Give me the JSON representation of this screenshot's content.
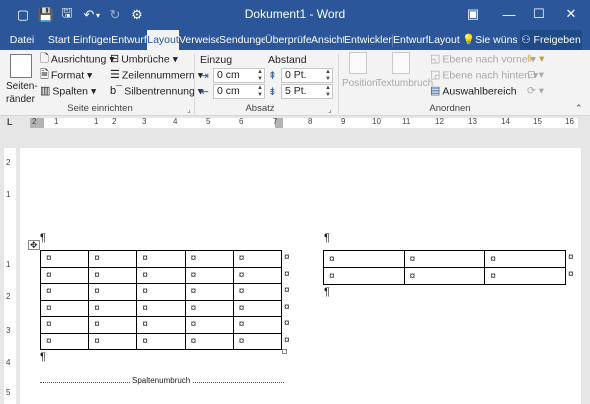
{
  "window": {
    "title": "Dokument1 - Word",
    "controls": {
      "options": "▣",
      "minimize": "—",
      "maximize": "☐",
      "close": "✕"
    }
  },
  "quick_access": {
    "autosave": "▢",
    "save": "💾",
    "save_as": "🖫",
    "undo": "↶",
    "undo_arrow": "▾",
    "redo": "↻",
    "custom": "⚙"
  },
  "tabs": [
    "Datei",
    "Start",
    "Einfügen",
    "Entwurf",
    "Layout",
    "Verweise",
    "Sendungen",
    "Überprüfen",
    "Ansicht",
    "Entwicklertools",
    "Entwurf",
    "Layout"
  ],
  "tell_me": "Sie wünschen...",
  "share": "Freigeben",
  "ribbon": {
    "seite": {
      "margins_line1": "Seiten-",
      "margins_line2": "ränder",
      "orientation": "Ausrichtung",
      "size": "Format",
      "columns": "Spalten",
      "breaks": "Umbrüche",
      "line_numbers": "Zeilennummern",
      "hyphenation": "Silbentrennung",
      "group_label": "Seite einrichten"
    },
    "absatz": {
      "indent_label": "Einzug",
      "spacing_label": "Abstand",
      "indent_left": "0 cm",
      "indent_right": "0 cm",
      "spacing_before": "0 Pt.",
      "spacing_after": "5 Pt.",
      "group_label": "Absatz"
    },
    "anordnen": {
      "position": "Position",
      "wrap": "Textumbruch",
      "bring_forward": "Ebene nach vorne",
      "send_backward": "Ebene nach hinten",
      "selection_pane": "Auswahlbereich",
      "group_label": "Anordnen"
    }
  },
  "ruler": {
    "numbers": [
      "2",
      "1",
      "1",
      "2",
      "3",
      "4",
      "5",
      "6",
      "7",
      "8",
      "9",
      "10",
      "11",
      "12",
      "13",
      "14",
      "15",
      "16"
    ]
  },
  "vruler": {
    "numbers": [
      "2",
      "1",
      "1",
      "2",
      "3",
      "4",
      "5"
    ]
  },
  "document": {
    "pilcrow": "¶",
    "cell_mark": "¤",
    "move_handle": "✥",
    "table_left": {
      "rows": 6,
      "cols": 5
    },
    "table_right": {
      "rows": 2,
      "cols": 3
    },
    "column_break_label": "Spaltenumbruch"
  },
  "colors": {
    "accent": "#2b579a",
    "ribbon_bg": "#f3f3f3"
  }
}
